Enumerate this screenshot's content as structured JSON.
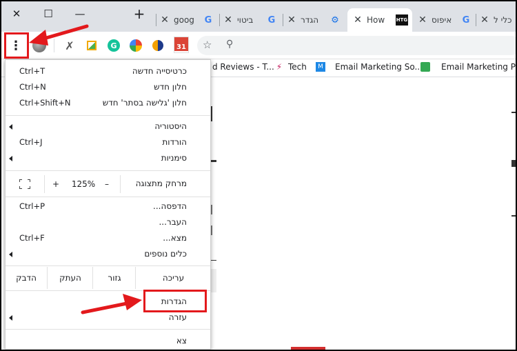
{
  "window": {
    "close_glyph": "✕",
    "maximize_glyph": "☐",
    "minimize_glyph": "—",
    "new_tab_glyph": "+"
  },
  "tabs": [
    {
      "title": "goog",
      "favicon": "G"
    },
    {
      "title": "ביטוי",
      "favicon": "G"
    },
    {
      "title": "הגדר",
      "favicon": "⚙"
    },
    {
      "title": "How",
      "favicon": "HTG"
    },
    {
      "title": "איפוס",
      "favicon": "G"
    },
    {
      "title": "כלי ל",
      "favicon": ""
    }
  ],
  "tab_close_glyph": "✕",
  "toolbar": {
    "menu_glyph": "⋮",
    "calendar_badge": "31"
  },
  "bookmarks": [
    {
      "label": "d Reviews - T..."
    },
    {
      "label": "Tech"
    },
    {
      "label": "Email Marketing So..."
    },
    {
      "label": "Email Marketing Pla"
    }
  ],
  "menu": {
    "new_tab": {
      "label": "כרטיסייה חדשה",
      "shortcut": "Ctrl+T"
    },
    "new_window": {
      "label": "חלון חדש",
      "shortcut": "Ctrl+N"
    },
    "incognito": {
      "label": "חלון 'גלישה בסתר' חדש",
      "shortcut": "Ctrl+Shift+N"
    },
    "history": {
      "label": "היסטוריה"
    },
    "downloads": {
      "label": "הורדות",
      "shortcut": "Ctrl+J"
    },
    "bookmarks": {
      "label": "סימניות"
    },
    "zoom": {
      "label": "מרחק מתצוגה",
      "minus": "–",
      "value": "125%",
      "plus": "+"
    },
    "print": {
      "label": "הדפסה...",
      "shortcut": "Ctrl+P"
    },
    "cast": {
      "label": "העבר..."
    },
    "find": {
      "label": "מצא...",
      "shortcut": "Ctrl+F"
    },
    "more_tools": {
      "label": "כלים נוספים"
    },
    "edit": {
      "label": "עריכה",
      "cut": "גזור",
      "copy": "העתק",
      "paste": "הדבק"
    },
    "settings": {
      "label": "הגדרות"
    },
    "help": {
      "label": "עזרה"
    },
    "exit": {
      "label": "צא"
    }
  },
  "colors": {
    "annotation_red": "#e3191c",
    "tab_strip": "#dee1e6"
  }
}
